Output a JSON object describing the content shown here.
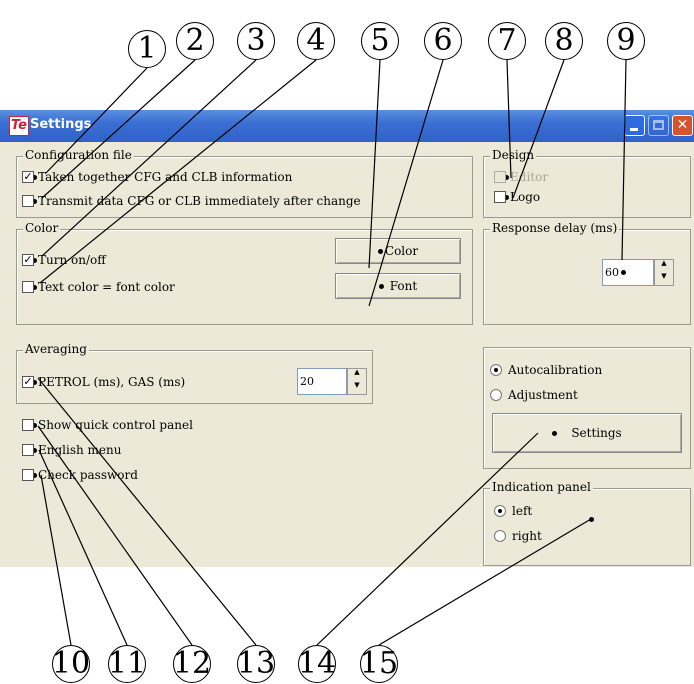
{
  "window": {
    "title": "Settings",
    "icon_text": "Te",
    "close_glyph": "✕"
  },
  "config_file": {
    "legend": "Configuration file",
    "items": [
      {
        "label": "Taken together CFG and CLB information",
        "checked": true
      },
      {
        "label": "Transmit data CFG or CLB immediately after change",
        "checked": false
      }
    ]
  },
  "design": {
    "legend": "Design",
    "items": [
      {
        "label": "Editor",
        "checked": false,
        "enabled": false
      },
      {
        "label": "Logo",
        "checked": false,
        "enabled": true
      }
    ]
  },
  "color": {
    "legend": "Color",
    "items": [
      {
        "label": "Turn on/off",
        "checked": true
      },
      {
        "label": "Text color = font color",
        "checked": false
      }
    ],
    "color_button": "Color",
    "font_button": "Font"
  },
  "response_delay": {
    "legend": "Response delay (ms)",
    "value": "60"
  },
  "averaging": {
    "legend": "Averaging",
    "label": "PETROL (ms), GAS (ms)",
    "checked": true,
    "value": "20"
  },
  "calibration": {
    "options": [
      {
        "label": "Autocalibration",
        "selected": true
      },
      {
        "label": "Adjustment",
        "selected": false
      }
    ],
    "settings_button": "Settings"
  },
  "misc": [
    {
      "label": "Show quick control panel",
      "checked": false
    },
    {
      "label": "English menu",
      "checked": false
    },
    {
      "label": "Check password",
      "checked": false
    }
  ],
  "indication_panel": {
    "legend": "Indication panel",
    "options": [
      {
        "label": "left",
        "selected": true
      },
      {
        "label": "right",
        "selected": false
      }
    ]
  },
  "callouts": [
    "1",
    "2",
    "3",
    "4",
    "5",
    "6",
    "7",
    "8",
    "9",
    "10",
    "11",
    "12",
    "13",
    "14",
    "15"
  ],
  "check_glyph": "✓",
  "spin_up": "▲",
  "spin_down": "▼"
}
